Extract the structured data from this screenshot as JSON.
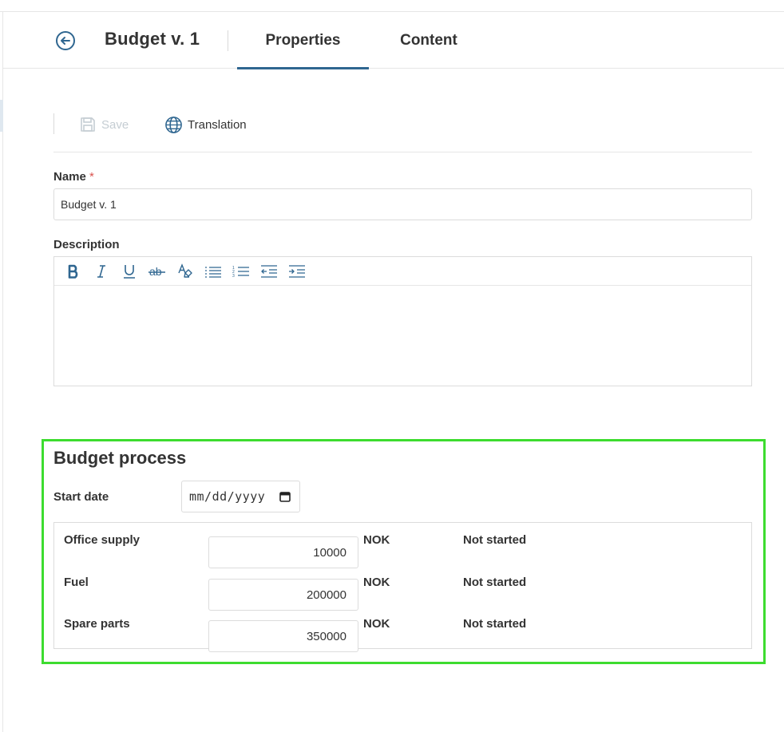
{
  "header": {
    "title": "Budget v. 1",
    "tabs": [
      {
        "label": "Properties",
        "active": true
      },
      {
        "label": "Content",
        "active": false
      }
    ]
  },
  "toolbar": {
    "save_label": "Save",
    "translation_label": "Translation"
  },
  "form": {
    "name_label": "Name",
    "name_required_mark": "*",
    "name_value": "Budget v. 1",
    "description_label": "Description",
    "editor_tools": [
      "bold-icon",
      "italic-icon",
      "underline-icon",
      "strikethrough-icon",
      "clear-format-icon",
      "bullet-list-icon",
      "numbered-list-icon",
      "outdent-icon",
      "indent-icon"
    ]
  },
  "budget": {
    "title": "Budget process",
    "start_date_label": "Start date",
    "start_date_placeholder": "mm/dd/yyyy",
    "items": [
      {
        "name": "Office supply",
        "amount": "10000",
        "currency": "NOK",
        "status": "Not started"
      },
      {
        "name": "Fuel",
        "amount": "200000",
        "currency": "NOK",
        "status": "Not started"
      },
      {
        "name": "Spare parts",
        "amount": "350000",
        "currency": "NOK",
        "status": "Not started"
      }
    ]
  },
  "colors": {
    "accent": "#2f6690",
    "highlight_border": "#3ddc2f",
    "required": "#d9534f",
    "disabled": "#c5cdd3"
  }
}
